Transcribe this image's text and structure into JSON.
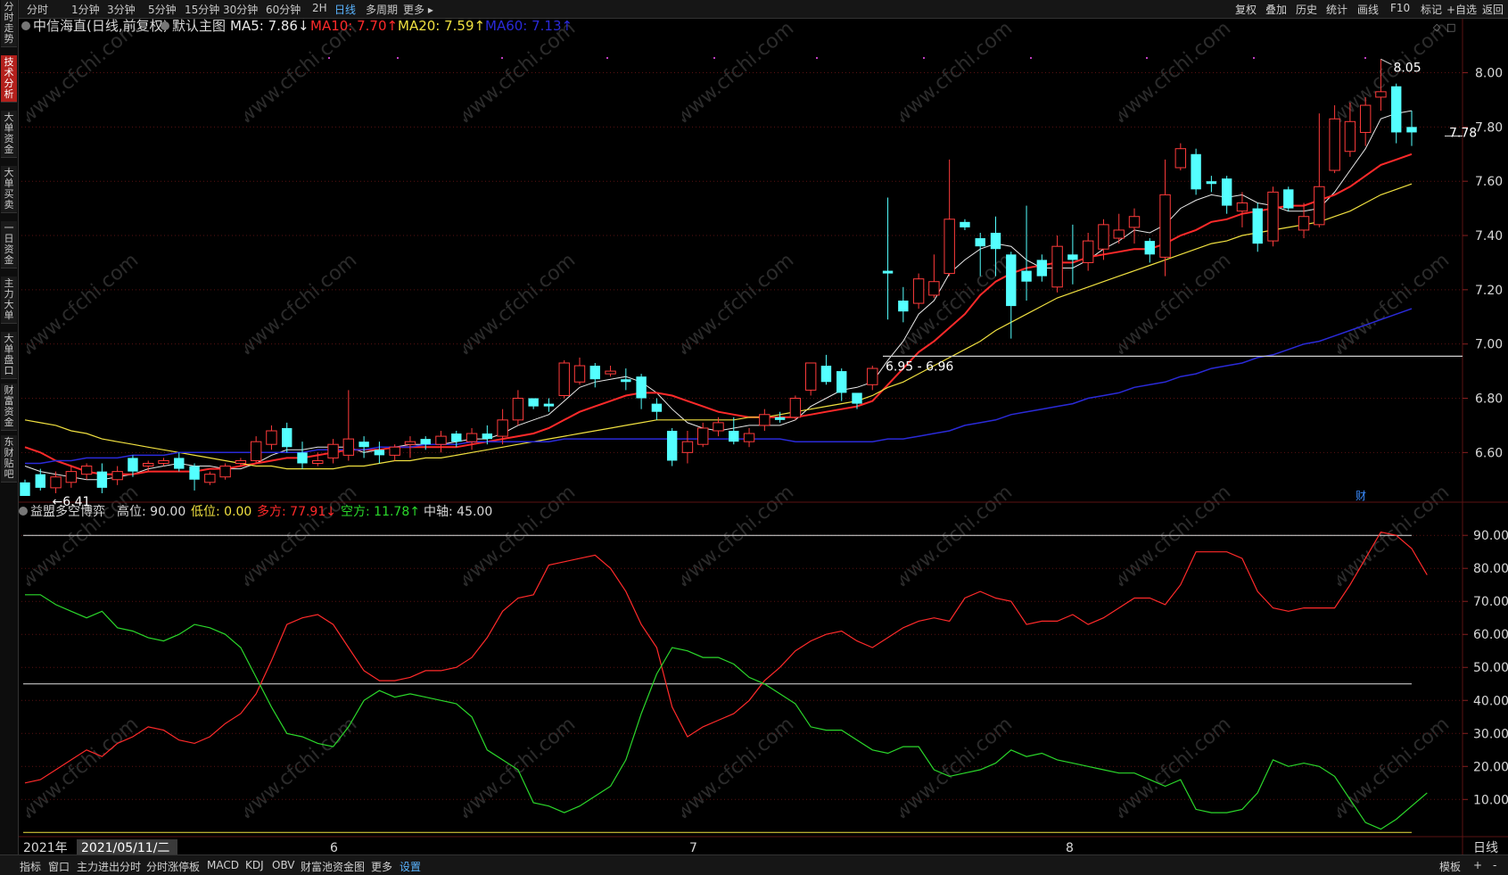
{
  "top_menu": {
    "left": [
      "分时",
      "1分钟",
      "3分钟",
      "5分钟",
      "15分钟",
      "30分钟",
      "60分钟",
      "2H",
      "日线",
      "多周期",
      "更多 ▸"
    ],
    "active": "日线",
    "right": [
      "复权",
      "叠加",
      "历史",
      "统计",
      "画线",
      "F10",
      "标记",
      "+自选",
      "返回"
    ]
  },
  "sidebar_tabs": [
    {
      "label": "分\n时\n走\n势",
      "active": false
    },
    {
      "label": "技\n术\n分\n析",
      "active": true
    },
    {
      "label": "大\n单\n资\n金",
      "active": false
    },
    {
      "label": "大\n单\n买\n卖",
      "active": false
    },
    {
      "label": "一\n日\n资\n金",
      "active": false
    },
    {
      "label": "主\n力\n大\n单",
      "active": false
    },
    {
      "label": "大\n单\n盘\n口",
      "active": false
    },
    {
      "label": "财\n富\n资\n金",
      "active": false
    },
    {
      "label": "东\n财\n贴\n吧",
      "active": false
    }
  ],
  "main_chart": {
    "title": "中信海直(日线,前复权)",
    "template": "默认主图",
    "ma": [
      {
        "label": "MA5: 7.86↓",
        "color": "#e8e8e8"
      },
      {
        "label": "MA10: 7.70↑",
        "color": "#ff2a2a"
      },
      {
        "label": "MA20: 7.59↑",
        "color": "#f0e040"
      },
      {
        "label": "MA60: 7.13↑",
        "color": "#2a2ad8"
      }
    ],
    "y_ticks": [
      "8.00",
      "7.80",
      "7.60",
      "7.40",
      "7.20",
      "7.00",
      "6.80",
      "6.60"
    ],
    "ylim": [
      6.44,
      8.13
    ],
    "current_price": "7.78",
    "high_label": "8.05",
    "low_label": "6.41",
    "support_label": "6.95 - 6.96",
    "finance_marker": "财",
    "colors": {
      "up": "#ff3b3b",
      "down": "#54ffff",
      "ma5": "#e8e8e8",
      "ma10": "#ff2a2a",
      "ma20": "#f0e040",
      "ma60": "#2a2ad8",
      "grid": "#5a1212"
    }
  },
  "chart_data": {
    "type": "candlestick",
    "candles": [
      [
        6.49,
        6.44,
        6.5,
        6.49
      ],
      [
        6.52,
        6.47,
        6.54,
        6.46
      ],
      [
        6.47,
        6.51,
        6.53,
        6.45
      ],
      [
        6.49,
        6.53,
        6.55,
        6.47
      ],
      [
        6.52,
        6.55,
        6.56,
        6.5
      ],
      [
        6.53,
        6.47,
        6.56,
        6.45
      ],
      [
        6.5,
        6.53,
        6.55,
        6.48
      ],
      [
        6.58,
        6.53,
        6.59,
        6.51
      ],
      [
        6.55,
        6.56,
        6.57,
        6.53
      ],
      [
        6.56,
        6.57,
        6.58,
        6.55
      ],
      [
        6.58,
        6.54,
        6.6,
        6.53
      ],
      [
        6.55,
        6.5,
        6.56,
        6.46
      ],
      [
        6.49,
        6.52,
        6.53,
        6.48
      ],
      [
        6.51,
        6.55,
        6.56,
        6.5
      ],
      [
        6.56,
        6.57,
        6.58,
        6.55
      ],
      [
        6.57,
        6.64,
        6.66,
        6.56
      ],
      [
        6.63,
        6.68,
        6.7,
        6.61
      ],
      [
        6.69,
        6.62,
        6.71,
        6.6
      ],
      [
        6.6,
        6.56,
        6.64,
        6.54
      ],
      [
        6.56,
        6.57,
        6.6,
        6.55
      ],
      [
        6.58,
        6.63,
        6.65,
        6.56
      ],
      [
        6.59,
        6.65,
        6.83,
        6.57
      ],
      [
        6.64,
        6.62,
        6.66,
        6.58
      ],
      [
        6.61,
        6.59,
        6.64,
        6.56
      ],
      [
        6.59,
        6.62,
        6.63,
        6.57
      ],
      [
        6.63,
        6.64,
        6.66,
        6.58
      ],
      [
        6.65,
        6.63,
        6.66,
        6.61
      ],
      [
        6.63,
        6.66,
        6.68,
        6.6
      ],
      [
        6.67,
        6.64,
        6.68,
        6.62
      ],
      [
        6.64,
        6.67,
        6.69,
        6.61
      ],
      [
        6.67,
        6.65,
        6.7,
        6.63
      ],
      [
        6.66,
        6.72,
        6.76,
        6.63
      ],
      [
        6.72,
        6.8,
        6.83,
        6.7
      ],
      [
        6.8,
        6.77,
        6.8,
        6.76
      ],
      [
        6.78,
        6.77,
        6.8,
        6.75
      ],
      [
        6.81,
        6.93,
        6.94,
        6.8
      ],
      [
        6.86,
        6.92,
        6.95,
        6.85
      ],
      [
        6.92,
        6.87,
        6.93,
        6.84
      ],
      [
        6.89,
        6.9,
        6.92,
        6.88
      ],
      [
        6.87,
        6.86,
        6.91,
        6.83
      ],
      [
        6.88,
        6.8,
        6.89,
        6.76
      ],
      [
        6.78,
        6.75,
        6.8,
        6.72
      ],
      [
        6.68,
        6.57,
        6.69,
        6.55
      ],
      [
        6.6,
        6.64,
        6.68,
        6.56
      ],
      [
        6.63,
        6.69,
        6.71,
        6.62
      ],
      [
        6.68,
        6.71,
        6.73,
        6.66
      ],
      [
        6.68,
        6.64,
        6.73,
        6.63
      ],
      [
        6.64,
        6.67,
        6.69,
        6.62
      ],
      [
        6.7,
        6.74,
        6.76,
        6.68
      ],
      [
        6.73,
        6.72,
        6.75,
        6.71
      ],
      [
        6.73,
        6.8,
        6.81,
        6.72
      ],
      [
        6.83,
        6.93,
        6.93,
        6.81
      ],
      [
        6.92,
        6.86,
        6.96,
        6.85
      ],
      [
        6.9,
        6.82,
        6.91,
        6.79
      ],
      [
        6.82,
        6.78,
        6.8,
        6.76
      ],
      [
        6.85,
        6.91,
        6.92,
        6.83
      ],
      [
        7.27,
        7.26,
        7.54,
        7.09
      ],
      [
        7.16,
        7.12,
        7.21,
        7.08
      ],
      [
        7.15,
        7.24,
        7.26,
        7.13
      ],
      [
        7.18,
        7.23,
        7.33,
        7.17
      ],
      [
        7.26,
        7.46,
        7.68,
        7.25
      ],
      [
        7.45,
        7.43,
        7.46,
        7.42
      ],
      [
        7.39,
        7.36,
        7.41,
        7.25
      ],
      [
        7.41,
        7.35,
        7.47,
        7.25
      ],
      [
        7.33,
        7.14,
        7.34,
        7.02
      ],
      [
        7.27,
        7.23,
        7.51,
        7.16
      ],
      [
        7.31,
        7.25,
        7.33,
        7.23
      ],
      [
        7.21,
        7.36,
        7.4,
        7.19
      ],
      [
        7.33,
        7.31,
        7.44,
        7.22
      ],
      [
        7.3,
        7.38,
        7.41,
        7.27
      ],
      [
        7.35,
        7.44,
        7.46,
        7.31
      ],
      [
        7.39,
        7.42,
        7.48,
        7.37
      ],
      [
        7.43,
        7.47,
        7.5,
        7.37
      ],
      [
        7.38,
        7.33,
        7.39,
        7.3
      ],
      [
        7.32,
        7.55,
        7.68,
        7.25
      ],
      [
        7.65,
        7.72,
        7.74,
        7.64
      ],
      [
        7.7,
        7.57,
        7.72,
        7.55
      ],
      [
        7.6,
        7.59,
        7.62,
        7.56
      ],
      [
        7.61,
        7.51,
        7.62,
        7.48
      ],
      [
        7.49,
        7.52,
        7.56,
        7.43
      ],
      [
        7.5,
        7.37,
        7.52,
        7.34
      ],
      [
        7.38,
        7.56,
        7.58,
        7.36
      ],
      [
        7.57,
        7.5,
        7.58,
        7.49
      ],
      [
        7.42,
        7.47,
        7.52,
        7.39
      ],
      [
        7.44,
        7.58,
        7.85,
        7.43
      ],
      [
        7.64,
        7.83,
        7.88,
        7.63
      ],
      [
        7.71,
        7.82,
        7.89,
        7.69
      ],
      [
        7.78,
        7.88,
        7.91,
        7.73
      ],
      [
        7.91,
        7.93,
        8.05,
        7.86
      ],
      [
        7.95,
        7.78,
        7.96,
        7.74
      ],
      [
        7.8,
        7.78,
        7.86,
        7.73
      ]
    ],
    "ma_series": {
      "MA5": {
        "start": 0,
        "values": [
          6.55,
          6.53,
          6.52,
          6.51,
          6.5,
          6.5,
          6.51,
          6.52,
          6.54,
          6.55,
          6.56,
          6.55,
          6.55,
          6.54,
          6.54,
          6.56,
          6.59,
          6.61,
          6.61,
          6.62,
          6.62,
          6.62,
          6.6,
          6.61,
          6.62,
          6.63,
          6.63,
          6.63,
          6.64,
          6.65,
          6.65,
          6.67,
          6.7,
          6.72,
          6.74,
          6.79,
          6.84,
          6.86,
          6.87,
          6.88,
          6.86,
          6.82,
          6.76,
          6.71,
          6.69,
          6.68,
          6.69,
          6.7,
          6.7,
          6.7,
          6.72,
          6.77,
          6.8,
          6.83,
          6.84,
          6.86,
          6.94,
          7.01,
          7.11,
          7.16,
          7.26,
          7.31,
          7.35,
          7.37,
          7.36,
          7.31,
          7.28,
          7.28,
          7.28,
          7.31,
          7.35,
          7.38,
          7.42,
          7.41,
          7.44,
          7.5,
          7.53,
          7.55,
          7.54,
          7.55,
          7.52,
          7.51,
          7.49,
          7.49,
          7.5,
          7.56,
          7.64,
          7.72,
          7.83,
          7.85,
          7.86
        ]
      },
      "MA10": {
        "start": 0,
        "values": [
          6.62,
          6.6,
          6.57,
          6.55,
          6.53,
          6.52,
          6.52,
          6.52,
          6.53,
          6.53,
          6.53,
          6.53,
          6.54,
          6.54,
          6.55,
          6.56,
          6.57,
          6.58,
          6.58,
          6.59,
          6.6,
          6.61,
          6.61,
          6.61,
          6.62,
          6.62,
          6.62,
          6.62,
          6.62,
          6.63,
          6.64,
          6.65,
          6.66,
          6.67,
          6.69,
          6.72,
          6.75,
          6.77,
          6.79,
          6.81,
          6.82,
          6.82,
          6.81,
          6.79,
          6.77,
          6.75,
          6.74,
          6.73,
          6.73,
          6.73,
          6.73,
          6.74,
          6.75,
          6.76,
          6.77,
          6.79,
          6.85,
          6.91,
          6.97,
          7.01,
          7.06,
          7.11,
          7.18,
          7.23,
          7.26,
          7.28,
          7.29,
          7.3,
          7.3,
          7.32,
          7.33,
          7.34,
          7.35,
          7.35,
          7.37,
          7.4,
          7.42,
          7.45,
          7.46,
          7.48,
          7.49,
          7.5,
          7.51,
          7.51,
          7.53,
          7.55,
          7.58,
          7.62,
          7.66,
          7.68,
          7.7
        ]
      },
      "MA20": {
        "start": 0,
        "values": [
          6.72,
          6.71,
          6.7,
          6.68,
          6.67,
          6.65,
          6.64,
          6.63,
          6.62,
          6.61,
          6.6,
          6.59,
          6.58,
          6.57,
          6.56,
          6.55,
          6.55,
          6.54,
          6.54,
          6.54,
          6.54,
          6.55,
          6.55,
          6.56,
          6.57,
          6.57,
          6.58,
          6.58,
          6.59,
          6.6,
          6.61,
          6.62,
          6.63,
          6.64,
          6.65,
          6.66,
          6.67,
          6.68,
          6.69,
          6.7,
          6.71,
          6.72,
          6.72,
          6.72,
          6.72,
          6.72,
          6.72,
          6.73,
          6.73,
          6.74,
          6.75,
          6.76,
          6.77,
          6.78,
          6.79,
          6.81,
          6.84,
          6.86,
          6.89,
          6.92,
          6.95,
          6.98,
          7.01,
          7.05,
          7.08,
          7.11,
          7.14,
          7.17,
          7.19,
          7.21,
          7.23,
          7.25,
          7.27,
          7.29,
          7.31,
          7.33,
          7.35,
          7.37,
          7.38,
          7.4,
          7.41,
          7.42,
          7.43,
          7.44,
          7.45,
          7.47,
          7.49,
          7.52,
          7.55,
          7.57,
          7.59
        ]
      },
      "MA60": {
        "start": 0,
        "values": [
          6.56,
          6.56,
          6.57,
          6.57,
          6.58,
          6.58,
          6.58,
          6.59,
          6.59,
          6.59,
          6.6,
          6.6,
          6.6,
          6.6,
          6.6,
          6.6,
          6.6,
          6.6,
          6.6,
          6.61,
          6.61,
          6.61,
          6.61,
          6.62,
          6.62,
          6.62,
          6.63,
          6.63,
          6.63,
          6.64,
          6.64,
          6.64,
          6.64,
          6.64,
          6.64,
          6.65,
          6.65,
          6.65,
          6.65,
          6.65,
          6.65,
          6.65,
          6.65,
          6.65,
          6.65,
          6.65,
          6.65,
          6.65,
          6.65,
          6.65,
          6.64,
          6.64,
          6.64,
          6.64,
          6.64,
          6.64,
          6.65,
          6.65,
          6.66,
          6.67,
          6.68,
          6.7,
          6.71,
          6.72,
          6.74,
          6.75,
          6.76,
          6.77,
          6.78,
          6.8,
          6.81,
          6.82,
          6.84,
          6.85,
          6.86,
          6.88,
          6.89,
          6.91,
          6.92,
          6.93,
          6.95,
          6.96,
          6.98,
          7.0,
          7.01,
          7.03,
          7.05,
          7.07,
          7.09,
          7.11,
          7.13
        ]
      }
    },
    "indicator": {
      "name": "益盟多空博弈",
      "high_label": "高位: 90.00",
      "low_label": "低位: 0.00",
      "long_label": "多方: 77.91↓",
      "short_label": "空方: 11.78↑",
      "mid_label": "中轴: 45.00",
      "high": 90,
      "low": 0,
      "mid": 45,
      "ylim": [
        -1,
        96
      ],
      "y_ticks": [
        "90.00",
        "80.00",
        "70.00",
        "60.00",
        "50.00",
        "40.00",
        "30.00",
        "20.00",
        "10.00"
      ],
      "long": [
        15,
        16,
        19,
        22,
        25,
        23,
        27,
        29,
        32,
        31,
        28,
        27,
        29,
        33,
        36,
        42,
        52,
        63,
        65,
        66,
        63,
        56,
        49,
        46,
        46,
        47,
        49,
        49,
        50,
        53,
        59,
        67,
        71,
        72,
        81,
        82,
        83,
        84,
        80,
        73,
        63,
        56,
        38,
        29,
        32,
        34,
        36,
        40,
        46,
        50,
        55,
        58,
        60,
        61,
        58,
        56,
        59,
        62,
        64,
        65,
        64,
        71,
        73,
        71,
        70,
        63,
        64,
        64,
        66,
        63,
        65,
        68,
        71,
        71,
        69,
        75,
        85,
        85,
        85,
        83,
        73,
        68,
        67,
        68,
        68,
        68,
        75,
        83,
        91,
        90,
        86,
        78
      ],
      "short": [
        72,
        72,
        69,
        67,
        65,
        67,
        62,
        61,
        59,
        58,
        60,
        63,
        62,
        60,
        56,
        47,
        38,
        30,
        29,
        27,
        26,
        32,
        40,
        43,
        41,
        42,
        41,
        40,
        39,
        35,
        25,
        22,
        19,
        9,
        8,
        6,
        8,
        11,
        14,
        22,
        36,
        48,
        56,
        55,
        53,
        53,
        51,
        47,
        45,
        42,
        39,
        32,
        31,
        31,
        28,
        25,
        24,
        26,
        26,
        19,
        17,
        18,
        19,
        21,
        25,
        23,
        24,
        22,
        21,
        20,
        19,
        18,
        18,
        16,
        14,
        16,
        7,
        6,
        6,
        7,
        12,
        22,
        20,
        21,
        20,
        17,
        10,
        3,
        1,
        4,
        8,
        12
      ]
    },
    "x_labels": {
      "year": "2021年",
      "date_box": "2021/05/11/二",
      "months": [
        "6",
        "7",
        "8"
      ],
      "right": "日线"
    }
  },
  "bottom_menu": {
    "left": [
      "指标",
      "窗口",
      "主力进出分时",
      "分时涨停板",
      "MACD",
      "KDJ",
      "OBV",
      "财富池资金图",
      "更多",
      "设置"
    ],
    "accent": "设置",
    "right": [
      "模板",
      "+",
      "-"
    ]
  },
  "watermark": "www.cfchi.com"
}
